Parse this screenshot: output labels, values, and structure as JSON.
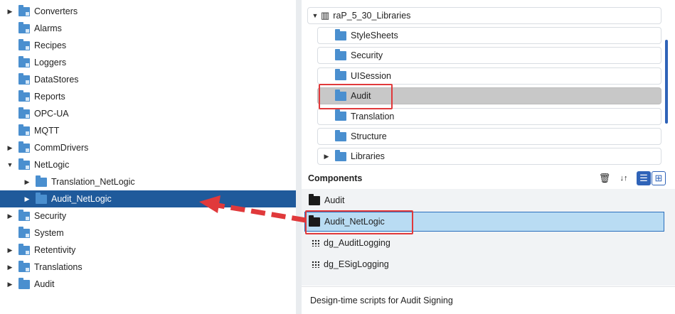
{
  "left_tree": [
    {
      "label": "Converters",
      "expander": "▶",
      "icon": "folder-settings-icon",
      "sel": false
    },
    {
      "label": "Alarms",
      "expander": "",
      "icon": "folder-alarm-icon",
      "sel": false
    },
    {
      "label": "Recipes",
      "expander": "",
      "icon": "folder-recipe-icon",
      "sel": false
    },
    {
      "label": "Loggers",
      "expander": "",
      "icon": "folder-logger-icon",
      "sel": false
    },
    {
      "label": "DataStores",
      "expander": "",
      "icon": "folder-datastore-icon",
      "sel": false
    },
    {
      "label": "Reports",
      "expander": "",
      "icon": "folder-report-icon",
      "sel": false
    },
    {
      "label": "OPC-UA",
      "expander": "",
      "icon": "folder-opcua-icon",
      "sel": false
    },
    {
      "label": "MQTT",
      "expander": "",
      "icon": "folder-mqtt-icon",
      "sel": false
    },
    {
      "label": "CommDrivers",
      "expander": "▶",
      "icon": "folder-commdriver-icon",
      "sel": false
    },
    {
      "label": "NetLogic",
      "expander": "▼",
      "icon": "folder-netlogic-icon",
      "sel": false
    },
    {
      "label": "Translation_NetLogic",
      "expander": "▶",
      "icon": "folder-icon",
      "sel": false,
      "indent": 1
    },
    {
      "label": "Audit_NetLogic",
      "expander": "▶",
      "icon": "folder-black-icon",
      "sel": true,
      "indent": 1
    },
    {
      "label": "Security",
      "expander": "▶",
      "icon": "folder-security-icon",
      "sel": false
    },
    {
      "label": "System",
      "expander": "",
      "icon": "folder-system-icon",
      "sel": false
    },
    {
      "label": "Retentivity",
      "expander": "▶",
      "icon": "folder-retentivity-icon",
      "sel": false
    },
    {
      "label": "Translations",
      "expander": "▶",
      "icon": "folder-translation-icon",
      "sel": false
    },
    {
      "label": "Audit",
      "expander": "▶",
      "icon": "folder-icon",
      "sel": false
    }
  ],
  "library": {
    "root_label": "raP_5_30_Libraries",
    "items": [
      "StyleSheets",
      "Security",
      "UISession",
      "Audit",
      "Translation",
      "Structure",
      "Libraries"
    ],
    "selected_index": 3
  },
  "components": {
    "title": "Components",
    "tools": {
      "delete": "🗑",
      "sort": "↓↑",
      "list": "☰",
      "grid": "⊞"
    },
    "items": [
      {
        "label": "Audit",
        "icon": "folder-black-icon"
      },
      {
        "label": "Audit_NetLogic",
        "icon": "folder-black-icon"
      },
      {
        "label": "dg_AuditLogging",
        "icon": "grid-icon"
      },
      {
        "label": "dg_ESigLogging",
        "icon": "grid-icon"
      }
    ],
    "selected_index": 1
  },
  "description": "Design-time scripts for Audit Signing",
  "colors": {
    "selection_left": "#1f5a9b",
    "selection_right": "#b9dcf3",
    "annotation": "#e0393b"
  }
}
